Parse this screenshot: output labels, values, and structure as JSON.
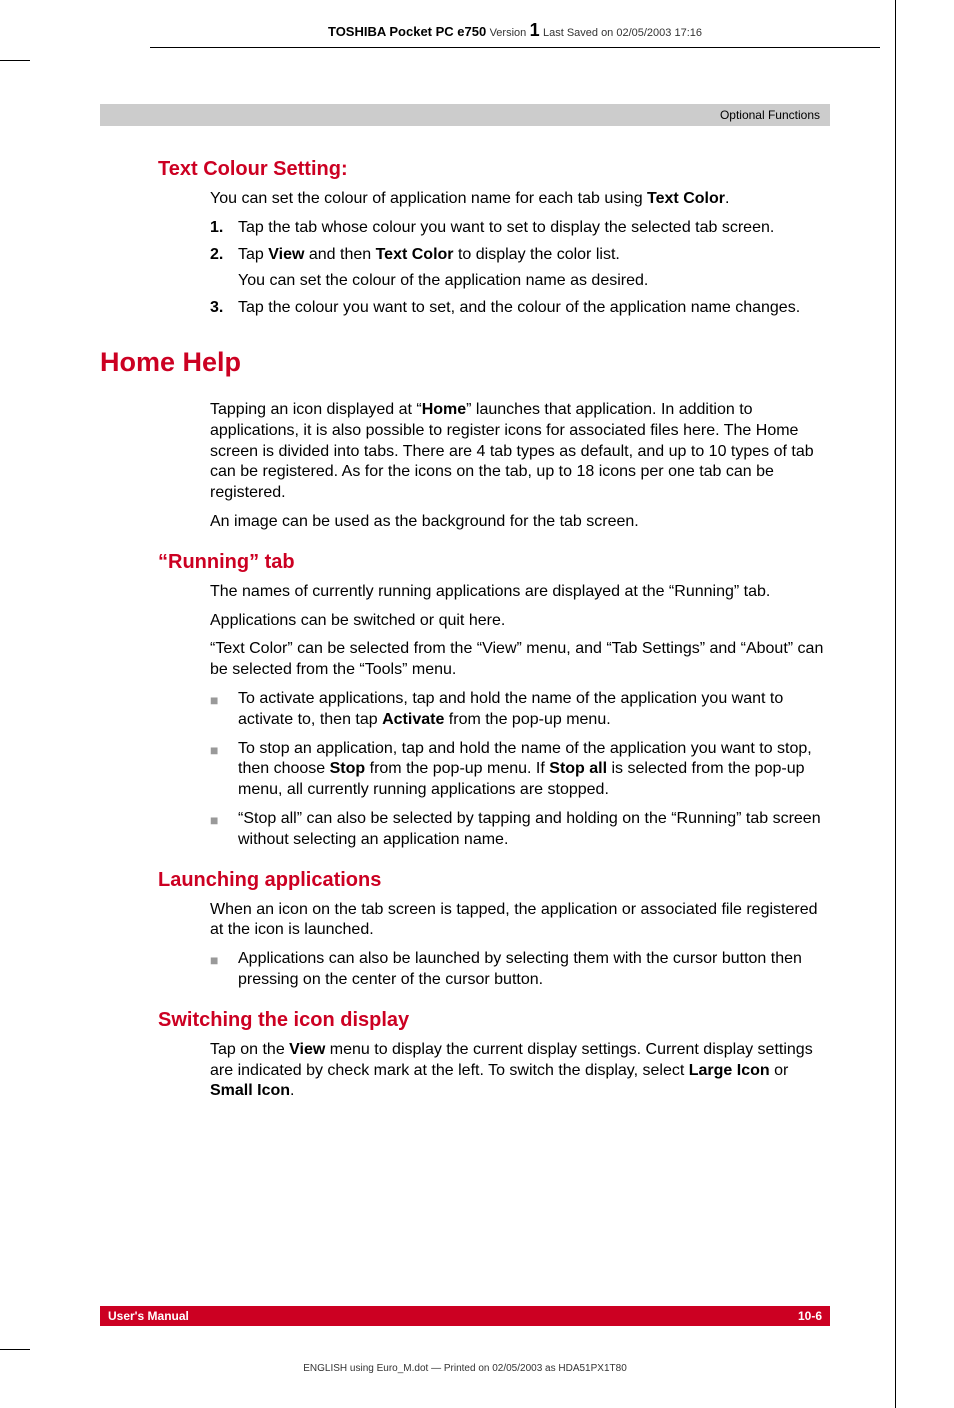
{
  "header": {
    "product": "TOSHIBA Pocket PC e750",
    "version_label": "Version",
    "version_num": "1",
    "saved": "Last Saved on 02/05/2003 17:16",
    "section": "Optional Functions"
  },
  "sections": {
    "textColour": {
      "heading": "Text Colour Setting:",
      "intro_a": "You can set the colour of application name for each tab using ",
      "intro_b": "Text Color",
      "intro_c": ".",
      "items": [
        {
          "n": "1.",
          "t": "Tap the tab whose colour you want to set to display the selected tab screen."
        },
        {
          "n": "2.",
          "t_a": "Tap ",
          "t_b": "View",
          "t_c": " and then ",
          "t_d": "Text Color",
          "t_e": " to display the color list.",
          "sub": "You can set the colour of the application name as desired."
        },
        {
          "n": "3.",
          "t": "Tap the colour you want to set, and the colour of the application name changes."
        }
      ]
    },
    "homeHelp": {
      "heading": "Home Help",
      "p1_a": "Tapping an icon displayed at “",
      "p1_b": "Home",
      "p1_c": "” launches that application. In addition to applications, it is also possible to register icons for associated files here. The Home screen is divided into tabs. There are 4 tab types as default, and up to 10 types of tab can be registered. As for the icons on the tab, up to 18 icons per one tab can be registered.",
      "p2": "An image can be used as the background for the tab screen."
    },
    "running": {
      "heading": "“Running” tab",
      "p1": "The names of currently running applications are displayed at the “Running” tab.",
      "p2": "Applications can be switched or quit here.",
      "p3": "“Text Color” can be selected from the “View” menu, and “Tab Settings” and “About” can be selected from the “Tools” menu.",
      "b1_a": "To activate applications, tap and hold the name of the application you want to activate to, then tap ",
      "b1_b": "Activate",
      "b1_c": " from the pop-up menu.",
      "b2_a": "To stop an application, tap and hold the name of the application you want to stop, then choose ",
      "b2_b": "Stop",
      "b2_c": " from the pop-up menu. If ",
      "b2_d": "Stop all",
      "b2_e": " is selected from the pop-up menu, all currently running applications are stopped.",
      "b3": "“Stop all” can also be selected by tapping and holding on the “Running” tab screen without selecting an application name."
    },
    "launching": {
      "heading": "Launching applications",
      "p1": "When an icon on the tab screen is tapped, the application or associated file registered at the icon is launched.",
      "b1": "Applications can also be launched by selecting them with the cursor button then pressing on the center of the cursor button."
    },
    "switching": {
      "heading": "Switching the icon display",
      "p1_a": "Tap on the ",
      "p1_b": "View",
      "p1_c": " menu to display the current display settings. Current display settings are indicated by check mark at the left. To switch the display, select ",
      "p1_d": "Large Icon",
      "p1_e": " or ",
      "p1_f": "Small Icon",
      "p1_g": "."
    }
  },
  "footer": {
    "left": "User's Manual",
    "right": "10-6",
    "bottom": "ENGLISH using Euro_M.dot — Printed on 02/05/2003 as HDA51PX1T80"
  }
}
